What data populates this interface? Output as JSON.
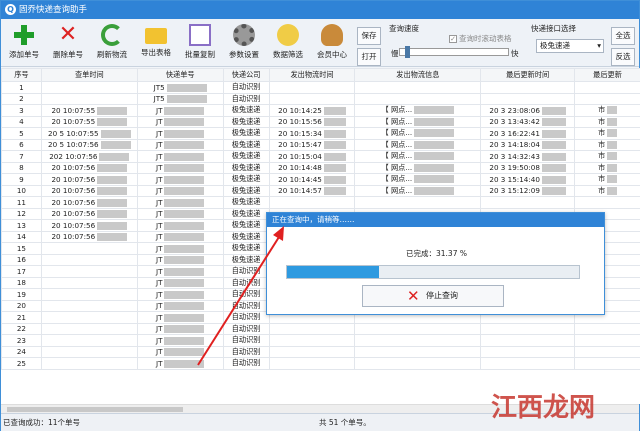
{
  "window": {
    "title": "固乔快递查询助手"
  },
  "toolbar": {
    "buttons": [
      {
        "label": "添加单号",
        "icon": "plus-icon"
      },
      {
        "label": "删除单号",
        "icon": "delete-x-icon"
      },
      {
        "label": "刷新物流",
        "icon": "refresh-icon"
      },
      {
        "label": "导出表格",
        "icon": "export-folder-icon"
      },
      {
        "label": "批量复制",
        "icon": "copy-icon"
      },
      {
        "label": "参数设置",
        "icon": "gear-icon"
      },
      {
        "label": "数据筛选",
        "icon": "filter-icon"
      },
      {
        "label": "会员中心",
        "icon": "member-icon"
      }
    ],
    "save_label": "保存",
    "open_label": "打开",
    "speed_group_label": "查询速度",
    "scroll_table_label": "查询时滚动表格",
    "slow_label": "慢",
    "fast_label": "快",
    "speed_level": 0.05,
    "api_group_label": "快递接口选择",
    "api_selected": "极兔速递",
    "select_all_label": "全选",
    "invert_label": "反选"
  },
  "table": {
    "headers": [
      "序号",
      "查单时间",
      "快递单号",
      "快递公司",
      "发出物流时间",
      "发出物流信息",
      "最后更新时间",
      "最后更新"
    ],
    "rows": [
      {
        "n": "1",
        "t": "",
        "no": "JT5",
        "co": "自动识别",
        "st": "",
        "si": "",
        "ut": "",
        "ui": ""
      },
      {
        "n": "2",
        "t": "",
        "no": "JT5",
        "co": "自动识别",
        "st": "",
        "si": "",
        "ut": "",
        "ui": ""
      },
      {
        "n": "3",
        "t": "20 10:07:55",
        "no": "JT",
        "co": "极兔速递",
        "st": "20 10:14:25",
        "si": "【 网点...",
        "ut": "20 3 23:08:06",
        "ui": "市"
      },
      {
        "n": "4",
        "t": "20 10:07:55",
        "no": "JT",
        "co": "极兔速递",
        "st": "20 10:15:56",
        "si": "【 网点...",
        "ut": "20 3 13:43:42",
        "ui": "市"
      },
      {
        "n": "5",
        "t": "20 5 10:07:55",
        "no": "JT",
        "co": "极兔速递",
        "st": "20 10:15:34",
        "si": "【 网点...",
        "ut": "20 3 16:22:41",
        "ui": "市"
      },
      {
        "n": "6",
        "t": "20 5 10:07:56",
        "no": "JT",
        "co": "极兔速递",
        "st": "20 10:15:47",
        "si": "【 网点...",
        "ut": "20 3 14:18:04",
        "ui": "市"
      },
      {
        "n": "7",
        "t": "202 10:07:56",
        "no": "JT",
        "co": "极兔速递",
        "st": "20 10:15:04",
        "si": "【 网点...",
        "ut": "20 3 14:32:43",
        "ui": "市"
      },
      {
        "n": "8",
        "t": "20 10:07:56",
        "no": "JT",
        "co": "极兔速递",
        "st": "20 10:14:48",
        "si": "【 网点...",
        "ut": "20 3 19:50:08",
        "ui": "市"
      },
      {
        "n": "9",
        "t": "20 10:07:56",
        "no": "JT",
        "co": "极兔速递",
        "st": "20 10:14:45",
        "si": "【 网点...",
        "ut": "20 3 15:14:40",
        "ui": "市"
      },
      {
        "n": "10",
        "t": "20 10:07:56",
        "no": "JT",
        "co": "极兔速递",
        "st": "20 10:14:57",
        "si": "【 网点...",
        "ut": "20 3 15:12:09",
        "ui": "市"
      },
      {
        "n": "11",
        "t": "20 10:07:56",
        "no": "JT",
        "co": "极兔速递",
        "st": "",
        "si": "",
        "ut": "",
        "ui": ""
      },
      {
        "n": "12",
        "t": "20 10:07:56",
        "no": "JT",
        "co": "极兔速递",
        "st": "",
        "si": "",
        "ut": "",
        "ui": ""
      },
      {
        "n": "13",
        "t": "20 10:07:56",
        "no": "JT",
        "co": "极兔速递",
        "st": "",
        "si": "",
        "ut": "",
        "ui": ""
      },
      {
        "n": "14",
        "t": "20 10:07:56",
        "no": "JT",
        "co": "极兔速递",
        "st": "",
        "si": "",
        "ut": "",
        "ui": ""
      },
      {
        "n": "15",
        "t": "",
        "no": "JT",
        "co": "极兔速递",
        "st": "",
        "si": "",
        "ut": "",
        "ui": ""
      },
      {
        "n": "16",
        "t": "",
        "no": "JT",
        "co": "极兔速递",
        "st": "",
        "si": "",
        "ut": "",
        "ui": ""
      },
      {
        "n": "17",
        "t": "",
        "no": "JT",
        "co": "自动识别",
        "st": "",
        "si": "",
        "ut": "",
        "ui": ""
      },
      {
        "n": "18",
        "t": "",
        "no": "JT",
        "co": "自动识别",
        "st": "",
        "si": "",
        "ut": "",
        "ui": ""
      },
      {
        "n": "19",
        "t": "",
        "no": "JT",
        "co": "自动识别",
        "st": "",
        "si": "",
        "ut": "",
        "ui": ""
      },
      {
        "n": "20",
        "t": "",
        "no": "JT",
        "co": "自动识别",
        "st": "",
        "si": "",
        "ut": "",
        "ui": ""
      },
      {
        "n": "21",
        "t": "",
        "no": "JT",
        "co": "自动识别",
        "st": "",
        "si": "",
        "ut": "",
        "ui": ""
      },
      {
        "n": "22",
        "t": "",
        "no": "JT",
        "co": "自动识别",
        "st": "",
        "si": "",
        "ut": "",
        "ui": ""
      },
      {
        "n": "23",
        "t": "",
        "no": "JT",
        "co": "自动识别",
        "st": "",
        "si": "",
        "ut": "",
        "ui": ""
      },
      {
        "n": "24",
        "t": "",
        "no": "JT",
        "co": "自动识别",
        "st": "",
        "si": "",
        "ut": "",
        "ui": ""
      },
      {
        "n": "25",
        "t": "",
        "no": "JT",
        "co": "自动识别",
        "st": "",
        "si": "",
        "ut": "",
        "ui": ""
      }
    ]
  },
  "dialog": {
    "title": "正在查询中，请稍等……",
    "done_text": "已完成：31.37 %",
    "progress": 0.3137,
    "stop_label": "停止查询"
  },
  "status": {
    "left": "已查询成功：11个单号",
    "mid": "共 51 个单号。"
  },
  "watermark": "江西龙网",
  "colors": {
    "accent": "#2f83d6",
    "progress": "#2e9ae0",
    "stop_icon": "#d22222",
    "watermark": "#c7372f"
  }
}
